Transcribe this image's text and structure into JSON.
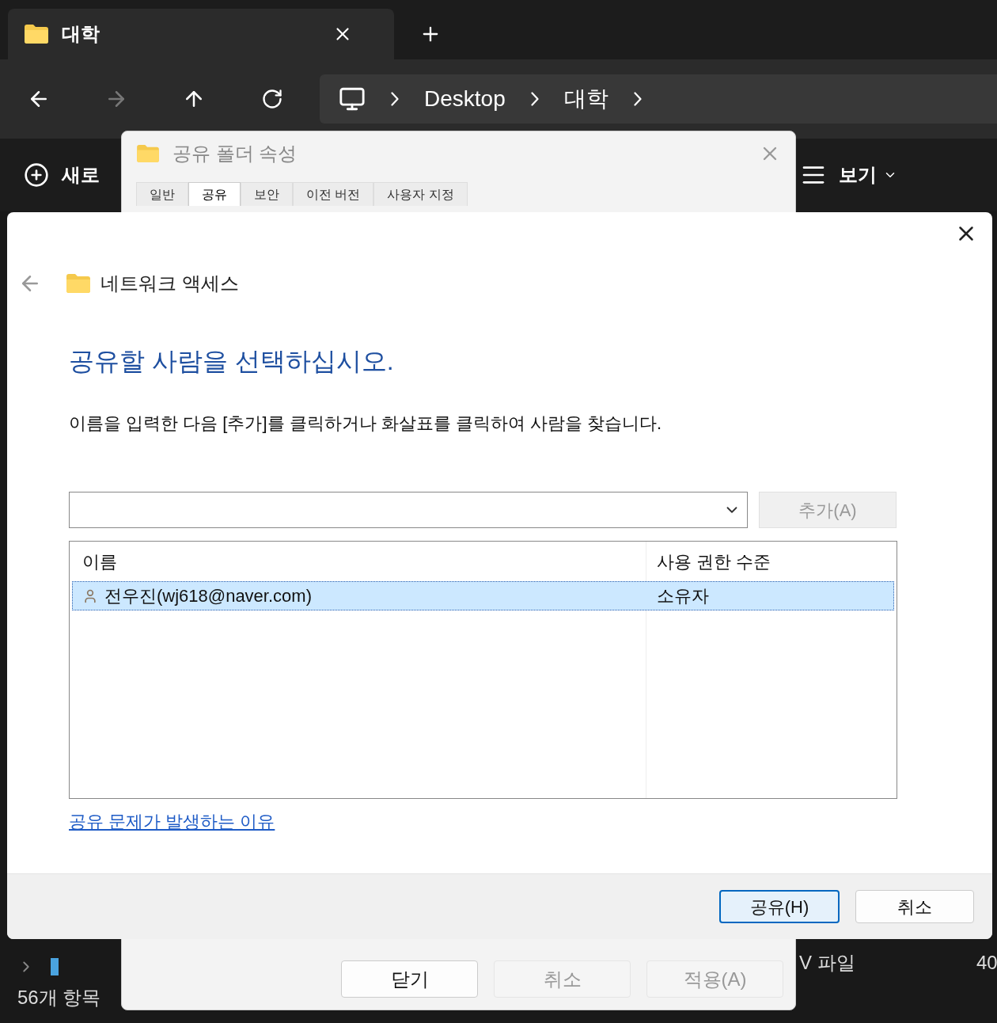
{
  "explorer": {
    "tab": {
      "title": "대학"
    },
    "address": [
      "Desktop",
      "대학"
    ],
    "command_bar": {
      "new_label": "새로",
      "view_label": "보기"
    },
    "status": "56개 항목",
    "list_fragments": [
      "V 파일",
      "40"
    ]
  },
  "properties_dialog": {
    "title": "공유 폴더 속성",
    "tabs": [
      {
        "label": "일반",
        "selected": false
      },
      {
        "label": "공유",
        "selected": true
      },
      {
        "label": "보안",
        "selected": false
      },
      {
        "label": "이전 버전",
        "selected": false
      },
      {
        "label": "사용자 지정",
        "selected": false
      }
    ],
    "buttons": [
      {
        "label": "닫기",
        "disabled": false
      },
      {
        "label": "취소",
        "disabled": true
      },
      {
        "label": "적용(A)",
        "disabled": true
      }
    ]
  },
  "wizard": {
    "title": "네트워크 액세스",
    "heading": "공유할 사람을 선택하십시오.",
    "instruction": "이름을 입력한 다음 [추가]를 클릭하거나 화살표를 클릭하여 사람을 찾습니다.",
    "add_button": {
      "label": "추가(A)",
      "disabled": true
    },
    "columns": [
      "이름",
      "사용 권한 수준"
    ],
    "rows": [
      {
        "name": "전우진(wj618@naver.com)",
        "permission": "소유자",
        "selected": true
      }
    ],
    "link": "공유 문제가 발생하는 이유",
    "buttons": [
      {
        "label": "공유(H)",
        "default": true
      },
      {
        "label": "취소",
        "default": false
      }
    ]
  }
}
